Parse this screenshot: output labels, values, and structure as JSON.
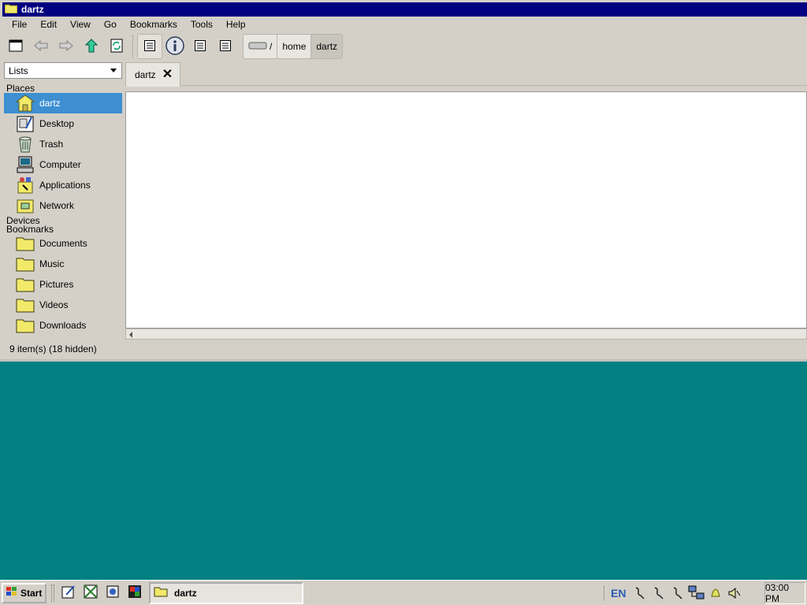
{
  "window": {
    "title": "dartz"
  },
  "menu": {
    "file": "File",
    "edit": "Edit",
    "view": "View",
    "go": "Go",
    "bookmarks": "Bookmarks",
    "tools": "Tools",
    "help": "Help"
  },
  "toolbar": {
    "icons": [
      "new-window-icon",
      "back-icon",
      "forward-icon",
      "up-icon",
      "reload-icon",
      "list-view-icon",
      "info-icon",
      "compact-view-icon",
      "detail-view-icon"
    ],
    "path": {
      "root": "/",
      "home": "home",
      "current": "dartz"
    }
  },
  "sidebar": {
    "mode": "Lists",
    "places_heading": "Places",
    "places": [
      {
        "label": "dartz",
        "icon": "home-folder-icon"
      },
      {
        "label": "Desktop",
        "icon": "desktop-icon"
      },
      {
        "label": "Trash",
        "icon": "trash-icon"
      },
      {
        "label": "Computer",
        "icon": "computer-icon"
      },
      {
        "label": "Applications",
        "icon": "applications-icon"
      },
      {
        "label": "Network",
        "icon": "network-icon"
      }
    ],
    "devices_heading": "Devices",
    "bookmarks_heading": "Bookmarks",
    "bookmarks": [
      {
        "label": "Documents",
        "icon": "folder-icon"
      },
      {
        "label": "Music",
        "icon": "folder-icon"
      },
      {
        "label": "Pictures",
        "icon": "folder-icon"
      },
      {
        "label": "Videos",
        "icon": "folder-icon"
      },
      {
        "label": "Downloads",
        "icon": "folder-icon"
      }
    ]
  },
  "tabs": [
    {
      "label": "dartz"
    }
  ],
  "status": "9 item(s) (18 hidden)",
  "taskbar": {
    "start": "Start",
    "task": "dartz",
    "lang": "EN",
    "clock": "03:00 PM"
  },
  "colors": {
    "titlebar": "#000080",
    "selection": "#3d8fd1",
    "desktop": "#008080",
    "folder": "#f2e96a"
  }
}
